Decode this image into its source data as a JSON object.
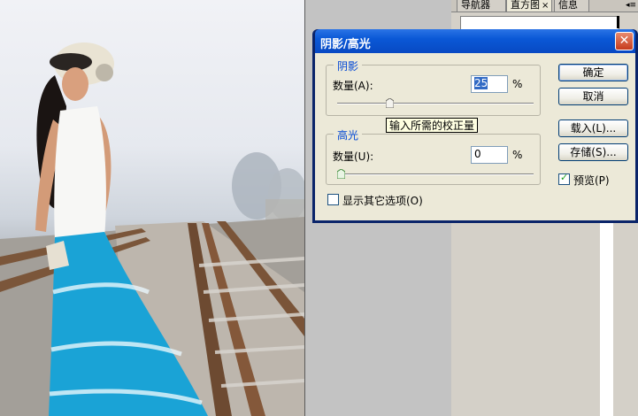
{
  "panel": {
    "tabs": [
      "导航器",
      "直方图",
      "信息"
    ],
    "close_glyph": "×",
    "menu_glyph": "◂≡"
  },
  "dialog": {
    "title": "阴影/高光",
    "close_glyph": "✕",
    "shadows": {
      "group_title": "阴影",
      "amount_label": "数量(A):",
      "amount_value": "25",
      "unit": "%",
      "slider_fraction": 0.25
    },
    "highlights": {
      "group_title": "高光",
      "amount_label": "数量(U):",
      "amount_value": "0",
      "unit": "%",
      "slider_fraction": 0
    },
    "tooltip": "输入所需的校正量",
    "buttons": {
      "ok": "确定",
      "cancel": "取消",
      "load": "载入(L)...",
      "save": "存储(S)..."
    },
    "preview": {
      "label": "预览(P)",
      "checked": true
    },
    "show_more": {
      "label": "显示其它选项(O)",
      "checked": false
    }
  }
}
